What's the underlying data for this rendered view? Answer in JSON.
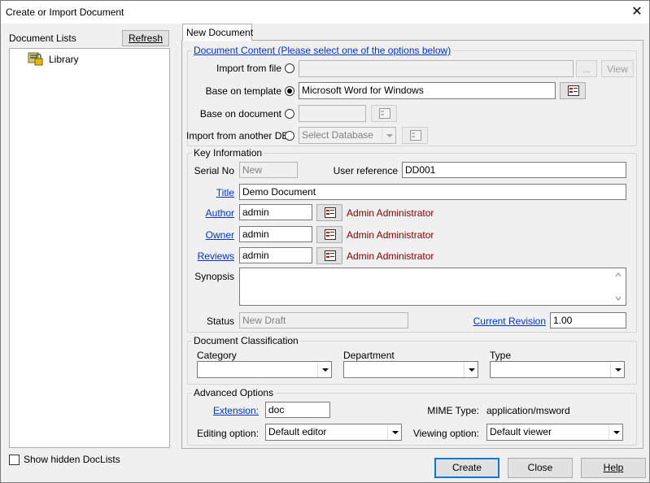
{
  "window": {
    "title": "Create or Import Document",
    "close_glyph": "✕"
  },
  "left_panel": {
    "header": "Document Lists",
    "refresh_label": "Refresh",
    "tree": [
      {
        "label": "Library",
        "icon": "library-lock-icon"
      }
    ],
    "show_hidden_label": "Show hidden DocLists"
  },
  "tab": {
    "label": "New Document"
  },
  "content": {
    "header_link": "Document Content (Please select one of the options below)",
    "import_file_label": "Import from file",
    "import_file_value": "",
    "ellipsis_label": "...",
    "view_label": "View",
    "template_label": "Base on template",
    "template_value": "Microsoft Word for Windows",
    "document_label": "Base on document",
    "document_value": "",
    "db_label": "Import from another DB",
    "db_placeholder": "Select Database"
  },
  "key_info": {
    "title": "Key Information",
    "serial_label": "Serial No",
    "serial_value": "New",
    "userref_label": "User reference",
    "userref_value": "DD001",
    "title_label": "Title",
    "title_value": "Demo Document",
    "author_label": "Author",
    "author_value": "admin",
    "author_name": "Admin Administrator",
    "owner_label": "Owner",
    "owner_value": "admin",
    "owner_name": "Admin Administrator",
    "reviews_label": "Reviews",
    "reviews_value": "admin",
    "reviews_name": "Admin Administrator",
    "synopsis_label": "Synopsis",
    "synopsis_value": "",
    "status_label": "Status",
    "status_value": "New Draft",
    "revision_label": "Current Revision",
    "revision_value": "1.00"
  },
  "classification": {
    "title": "Document Classification",
    "category_label": "Category",
    "category_value": "",
    "department_label": "Department",
    "department_value": "",
    "type_label": "Type",
    "type_value": ""
  },
  "advanced": {
    "title": "Advanced Options",
    "extension_label": "Extension:",
    "extension_value": "doc",
    "mime_label": "MIME Type:",
    "mime_value": "application/msword",
    "editing_label": "Editing option:",
    "editing_value": "Default editor",
    "viewing_label": "Viewing option:",
    "viewing_value": "Default viewer"
  },
  "footer": {
    "create_label": "Create",
    "close_label": "Close",
    "help_label": "Help"
  }
}
